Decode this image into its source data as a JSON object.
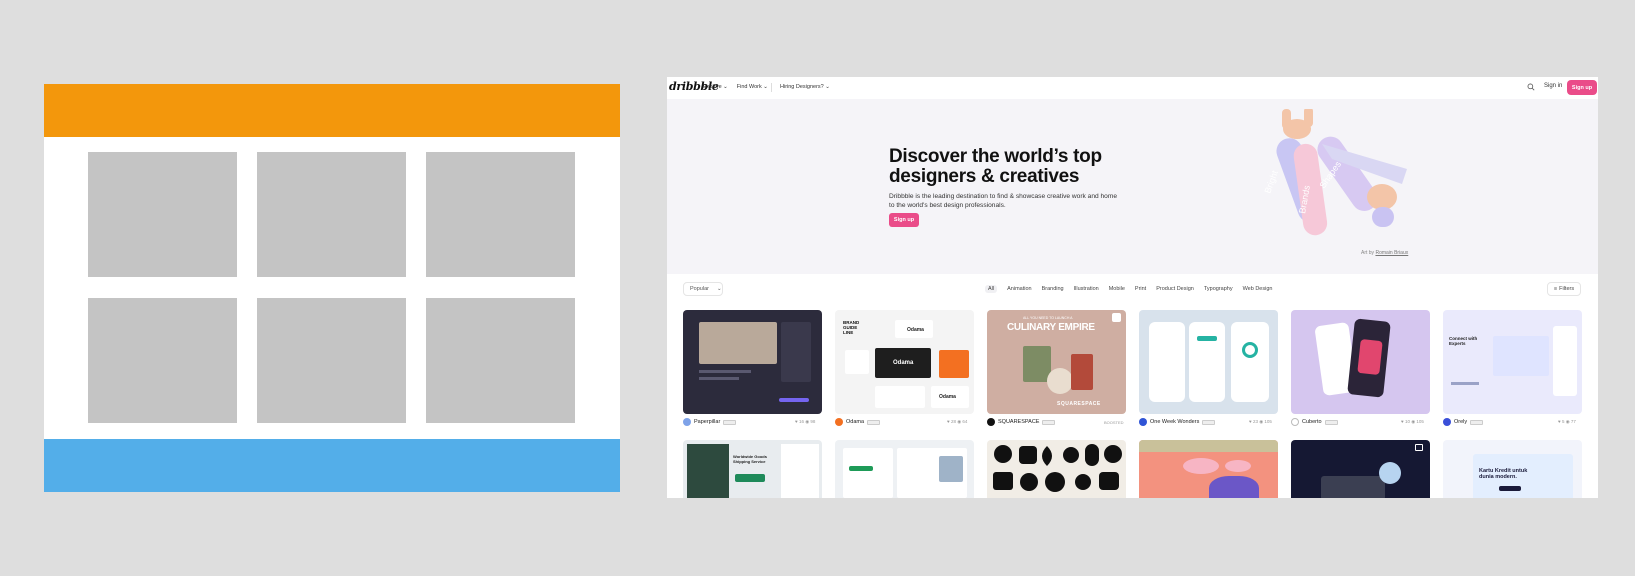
{
  "nav": {
    "logo": "dribbble",
    "explore": "Explore ⌄",
    "find_work": "Find Work ⌄",
    "hiring": "Hiring Designers? ⌄",
    "sign_in": "Sign in",
    "sign_up": "Sign up"
  },
  "hero": {
    "title": "Discover the world’s top designers & creatives",
    "description": "Dribbble is the leading destination to find & showcase creative work and home to the world's best design professionals.",
    "button": "Sign up",
    "art_prefix": "Art by ",
    "art_author": "Romain Briaux",
    "tags": [
      "Bright",
      "Brands",
      "Shapes"
    ]
  },
  "filters": {
    "popular": "Popular",
    "categories": [
      "All",
      "Animation",
      "Branding",
      "Illustration",
      "Mobile",
      "Print",
      "Product Design",
      "Typography",
      "Web Design"
    ],
    "filters_label": "Filters"
  },
  "shots": [
    {
      "author": "Paperpillar",
      "likes": "16",
      "views": "98"
    },
    {
      "author": "Odama",
      "likes": "28",
      "views": "64"
    },
    {
      "author": "SQUARESPACE",
      "badge": "BOOSTED"
    },
    {
      "author": "One Week Wonders",
      "likes": "23",
      "views": "105"
    },
    {
      "author": "Cuberto",
      "likes": "10",
      "views": "105"
    },
    {
      "author": "Orely",
      "likes": "5",
      "views": "77"
    }
  ],
  "shot_texts": {
    "odama_guide": "BRAND GUIDE LINE",
    "odama_logo": "Odama",
    "culinary_small": "ALL YOU NEED TO LAUNCH A",
    "culinary_big": "CULINARY EMPIRE",
    "squarespace_wordmark": "SQUARESPACE",
    "orely_heading": "Connect with Experts",
    "worldwide": "Worldwide Goods Shipping Service",
    "kartu": "Kartu Kredit untuk dunia modern."
  }
}
